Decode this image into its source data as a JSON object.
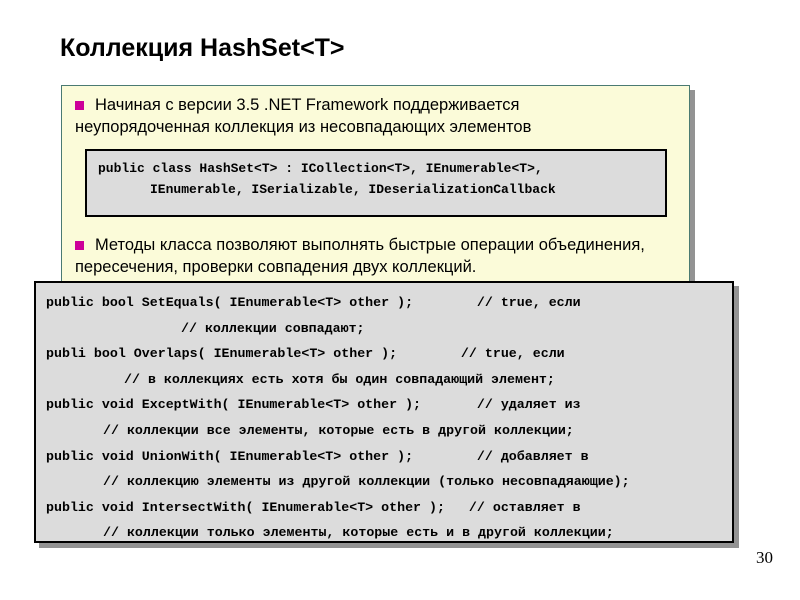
{
  "slide": {
    "title": "Коллекция HashSet<T>",
    "page_number": "30",
    "colors": {
      "panel_background": "#FBFBD9",
      "panel_border": "#4A7A72",
      "bullet_marker": "#CC0099",
      "code_background": "#DCDCDC",
      "code_border": "#000000",
      "shadow": "#808080",
      "text": "#000000"
    }
  },
  "panel": {
    "bullets": [
      {
        "marker": "square-bullet",
        "line1": "Начиная с версии 3.5 .NET Framework поддерживается",
        "line2": "неупорядоченная коллекция из несовпадающих элементов"
      },
      {
        "marker": "square-bullet",
        "line1": "Методы класса позволяют выполнять быстрые операции объединения,",
        "line2": "пересечения, проверки совпадения двух коллекций."
      }
    ],
    "declaration_code": {
      "lines": [
        {
          "indent": 0,
          "text": "public class HashSet<T> : ICollection<T>, IEnumerable<T>,"
        },
        {
          "indent": 1,
          "text": "IEnumerable, ISerializable, IDeserializationCallback"
        }
      ]
    }
  },
  "methods_code": {
    "lines": [
      {
        "indent": 0,
        "text": "public bool SetEquals( IEnumerable<T> other );        // true, если"
      },
      {
        "indent": 1,
        "text": "// коллекции совпадают;"
      },
      {
        "indent": 0,
        "text": "publi bool Overlaps( IEnumerable<T> other );        // true, если"
      },
      {
        "indent": 2,
        "text": "// в коллекциях есть хотя бы один совпадающий элемент;"
      },
      {
        "indent": 0,
        "text": "public void ExceptWith( IEnumerable<T> other );       // удаляет из"
      },
      {
        "indent": 3,
        "text": "// коллекции все элементы, которые есть в другой коллекции;"
      },
      {
        "indent": 0,
        "text": "public void UnionWith( IEnumerable<T> other );        // добавляет в"
      },
      {
        "indent": 3,
        "text": "// коллекцию элементы из другой коллекции (только несовпадяающие);"
      },
      {
        "indent": 0,
        "text": "public void IntersectWith( IEnumerable<T> other );   // оставляет в"
      },
      {
        "indent": 3,
        "text": "// коллекции только элементы, которые есть и в другой коллекции;"
      }
    ]
  }
}
